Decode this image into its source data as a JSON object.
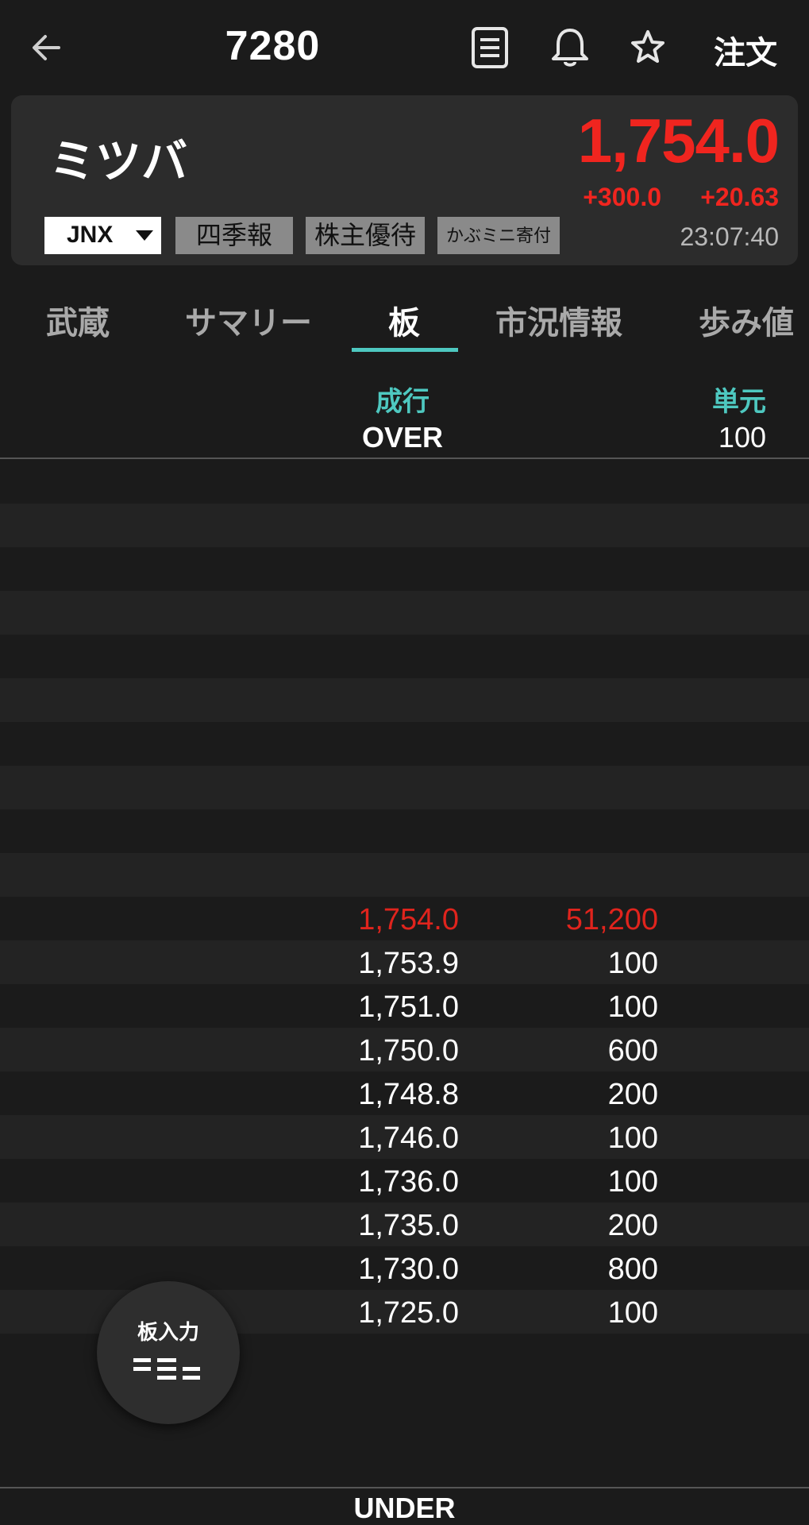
{
  "header": {
    "code": "7280",
    "order_label": "注文",
    "icons": [
      "back-arrow-icon",
      "document-icon",
      "bell-icon",
      "star-icon"
    ]
  },
  "stock": {
    "name": "ミツバ",
    "price": "1,754.0",
    "change": "+300.0",
    "change_pct": "+20.63",
    "time": "23:07:40",
    "market": "JNX",
    "tags": [
      "四季報",
      "株主優待",
      "かぶミニ寄付"
    ],
    "colors": {
      "up": "#f0251f",
      "accent": "#4ec8c0"
    }
  },
  "tabs": [
    "武蔵",
    "サマリー",
    "板",
    "市況情報",
    "歩み値"
  ],
  "active_tab": "板",
  "board": {
    "header_market_order": "成行",
    "header_unit": "単元",
    "over": "OVER",
    "unit": "100",
    "under": "UNDER",
    "rows": [
      {
        "price": "1,754.0",
        "qty": "51,200"
      },
      {
        "price": "1,753.9",
        "qty": "100"
      },
      {
        "price": "1,751.0",
        "qty": "100"
      },
      {
        "price": "1,750.0",
        "qty": "600"
      },
      {
        "price": "1,748.8",
        "qty": "200"
      },
      {
        "price": "1,746.0",
        "qty": "100"
      },
      {
        "price": "1,736.0",
        "qty": "100"
      },
      {
        "price": "1,735.0",
        "qty": "200"
      },
      {
        "price": "1,730.0",
        "qty": "800"
      },
      {
        "price": "1,725.0",
        "qty": "100"
      }
    ]
  },
  "fab": {
    "label": "板入力"
  }
}
